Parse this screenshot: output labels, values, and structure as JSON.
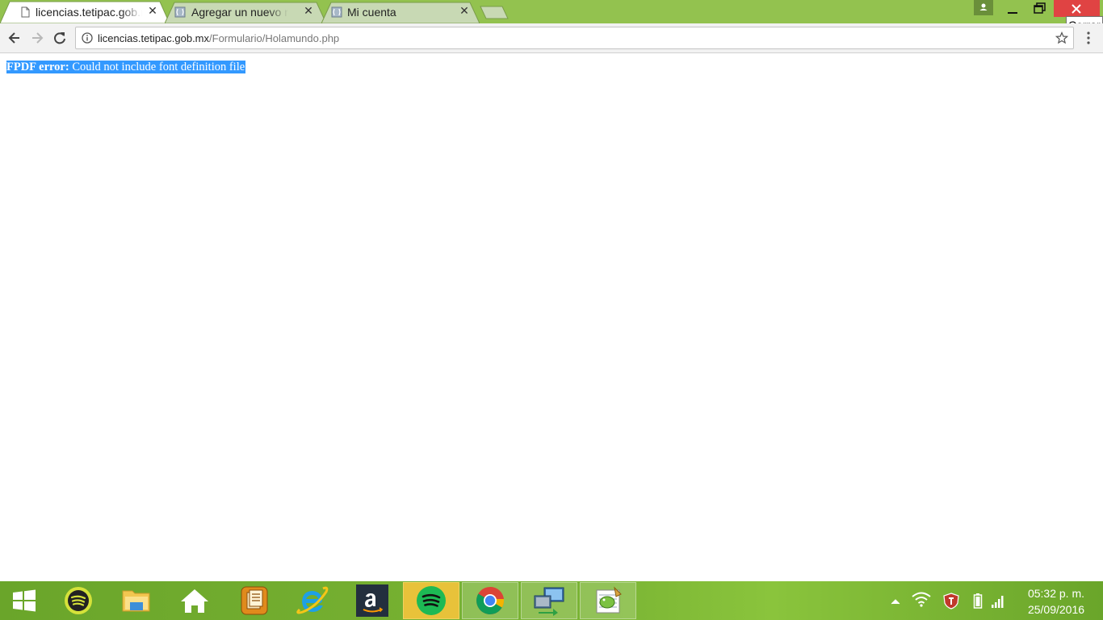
{
  "browser": {
    "tabs": [
      {
        "title": "licencias.tetipac.gob.mx/Formulario/Holamundo.php",
        "active": true
      },
      {
        "title": "Agregar un nuevo método de pago",
        "active": false
      },
      {
        "title": "Mi cuenta",
        "active": false
      }
    ],
    "close_tooltip": "Cerrar",
    "address": {
      "host": "licencias.tetipac.gob.mx",
      "path": "/Formulario/Holamundo.php"
    }
  },
  "page": {
    "error_label": "FPDF error:",
    "error_message": " Could not include font definition file"
  },
  "taskbar": {
    "apps": [
      "start",
      "spotify",
      "file-explorer",
      "home",
      "notes",
      "internet-explorer",
      "amazon",
      "spotify-active",
      "chrome",
      "remote-desktop",
      "notepad-plus"
    ],
    "clock": {
      "time": "05:32 p. m.",
      "date": "25/09/2016"
    }
  },
  "colors": {
    "chrome_frame": "#93c24f",
    "close_button": "#e04343",
    "selection": "#3399ff",
    "taskbar": "#7bb534"
  }
}
